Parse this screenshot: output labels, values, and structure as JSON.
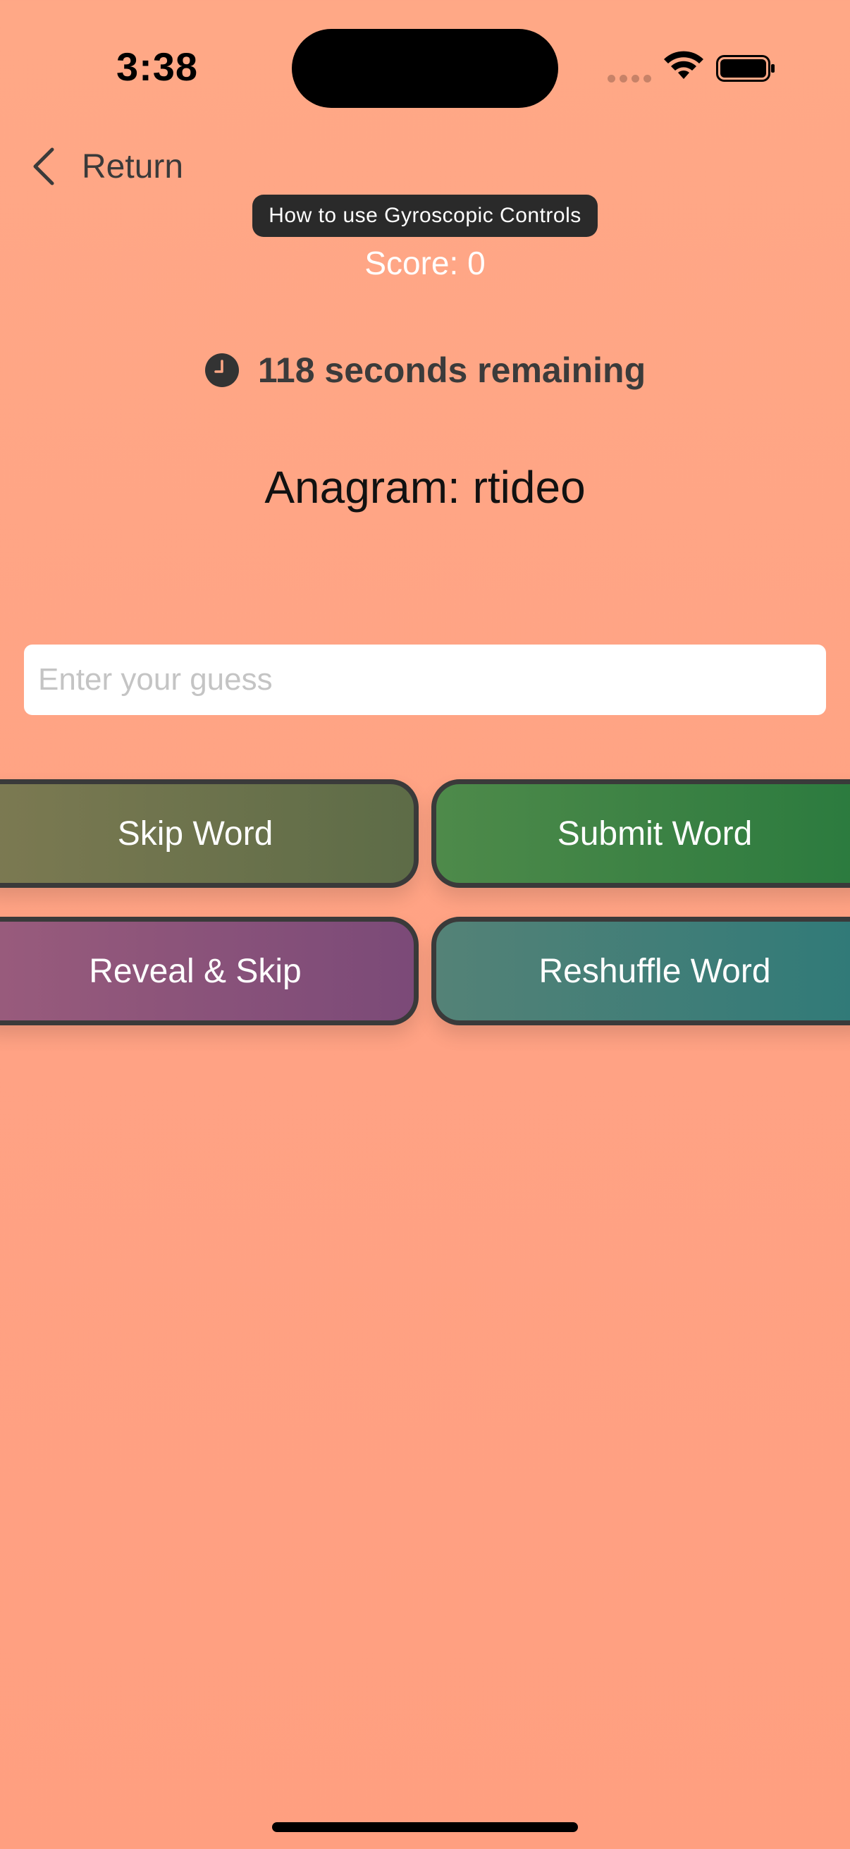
{
  "status_bar": {
    "time": "3:38"
  },
  "nav": {
    "back_label": "Return"
  },
  "help": {
    "gyro_label": "How to use Gyroscopic Controls"
  },
  "game": {
    "score_text": "Score: 0",
    "timer_text": "118 seconds remaining",
    "anagram_text": "Anagram: rtideo"
  },
  "guess": {
    "value": "",
    "placeholder": "Enter your guess"
  },
  "buttons": {
    "skip": "Skip Word",
    "submit": "Submit Word",
    "reveal": "Reveal & Skip",
    "reshuffle": "Reshuffle Word"
  },
  "icons": {
    "back": "chevron-left-icon",
    "timer": "clock-icon",
    "wifi": "wifi-icon",
    "battery": "battery-icon",
    "signal": "cellular-signal-icon"
  },
  "colors": {
    "background": "#ffa886",
    "skip_button": "#6e7350",
    "submit_button": "#3b8244",
    "reveal_button": "#8b5379",
    "reshuffle_button": "#417e77",
    "button_border": "#3a3a3a"
  }
}
